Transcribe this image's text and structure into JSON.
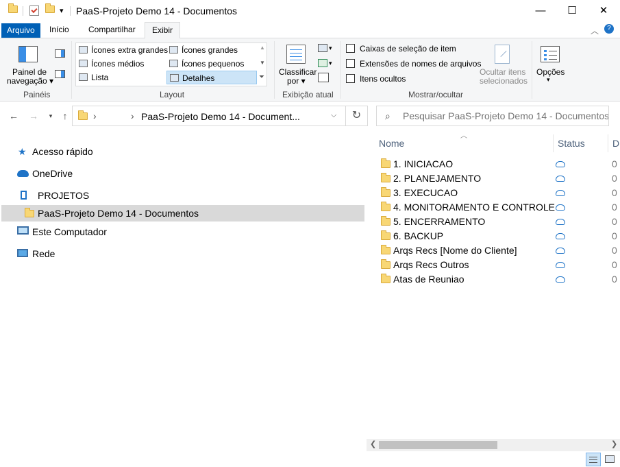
{
  "window": {
    "title": "PaaS-Projeto Demo 14 - Documentos",
    "minimize": "—",
    "maximize": "☐",
    "close": "✕"
  },
  "ribbon_tabs": [
    "Arquivo",
    "Início",
    "Compartilhar",
    "Exibir"
  ],
  "ribbon": {
    "paineis": {
      "nav_pane_label_1": "Painel de",
      "nav_pane_label_2": "navegação",
      "group_label": "Painéis"
    },
    "layout": {
      "items": [
        "Ícones extra grandes",
        "Ícones grandes",
        "Ícones médios",
        "Ícones pequenos",
        "Lista",
        "Detalhes"
      ],
      "group_label": "Layout"
    },
    "exibicao_atual": {
      "sort_label_1": "Classificar",
      "sort_label_2": "por",
      "group_label": "Exibição atual"
    },
    "mostrar_ocultar": {
      "checkboxes": [
        "Caixas de seleção de item",
        "Extensões de nomes de arquivos",
        "Itens ocultos"
      ],
      "hide_selected_1": "Ocultar itens",
      "hide_selected_2": "selecionados",
      "group_label": "Mostrar/ocultar"
    },
    "opcoes": {
      "label": "Opções"
    }
  },
  "address": {
    "path": "PaaS-Projeto Demo 14 - Document...",
    "chevron": "›"
  },
  "search": {
    "placeholder": "Pesquisar PaaS-Projeto Demo 14 - Documentos"
  },
  "nav_pane": {
    "items": [
      "Acesso rápido",
      "OneDrive",
      "PROJETOS",
      "PaaS-Projeto Demo 14 - Documentos",
      "Este Computador",
      "Rede"
    ]
  },
  "file_list": {
    "columns": [
      "Nome",
      "Status",
      "D"
    ],
    "rows": [
      {
        "name": "1. INICIACAO",
        "date": "0"
      },
      {
        "name": "2. PLANEJAMENTO",
        "date": "0"
      },
      {
        "name": "3. EXECUCAO",
        "date": "0"
      },
      {
        "name": "4. MONITORAMENTO E CONTROLE",
        "date": "0"
      },
      {
        "name": "5. ENCERRAMENTO",
        "date": "0"
      },
      {
        "name": "6. BACKUP",
        "date": "0"
      },
      {
        "name": "Arqs Recs [Nome do Cliente]",
        "date": "0"
      },
      {
        "name": "Arqs Recs Outros",
        "date": "0"
      },
      {
        "name": "Atas de Reuniao",
        "date": "0"
      }
    ]
  },
  "colors": {
    "accent": "#0060b6",
    "selection": "#cce4f7",
    "folder": "#f8d775",
    "cloud": "#1e73c7"
  }
}
